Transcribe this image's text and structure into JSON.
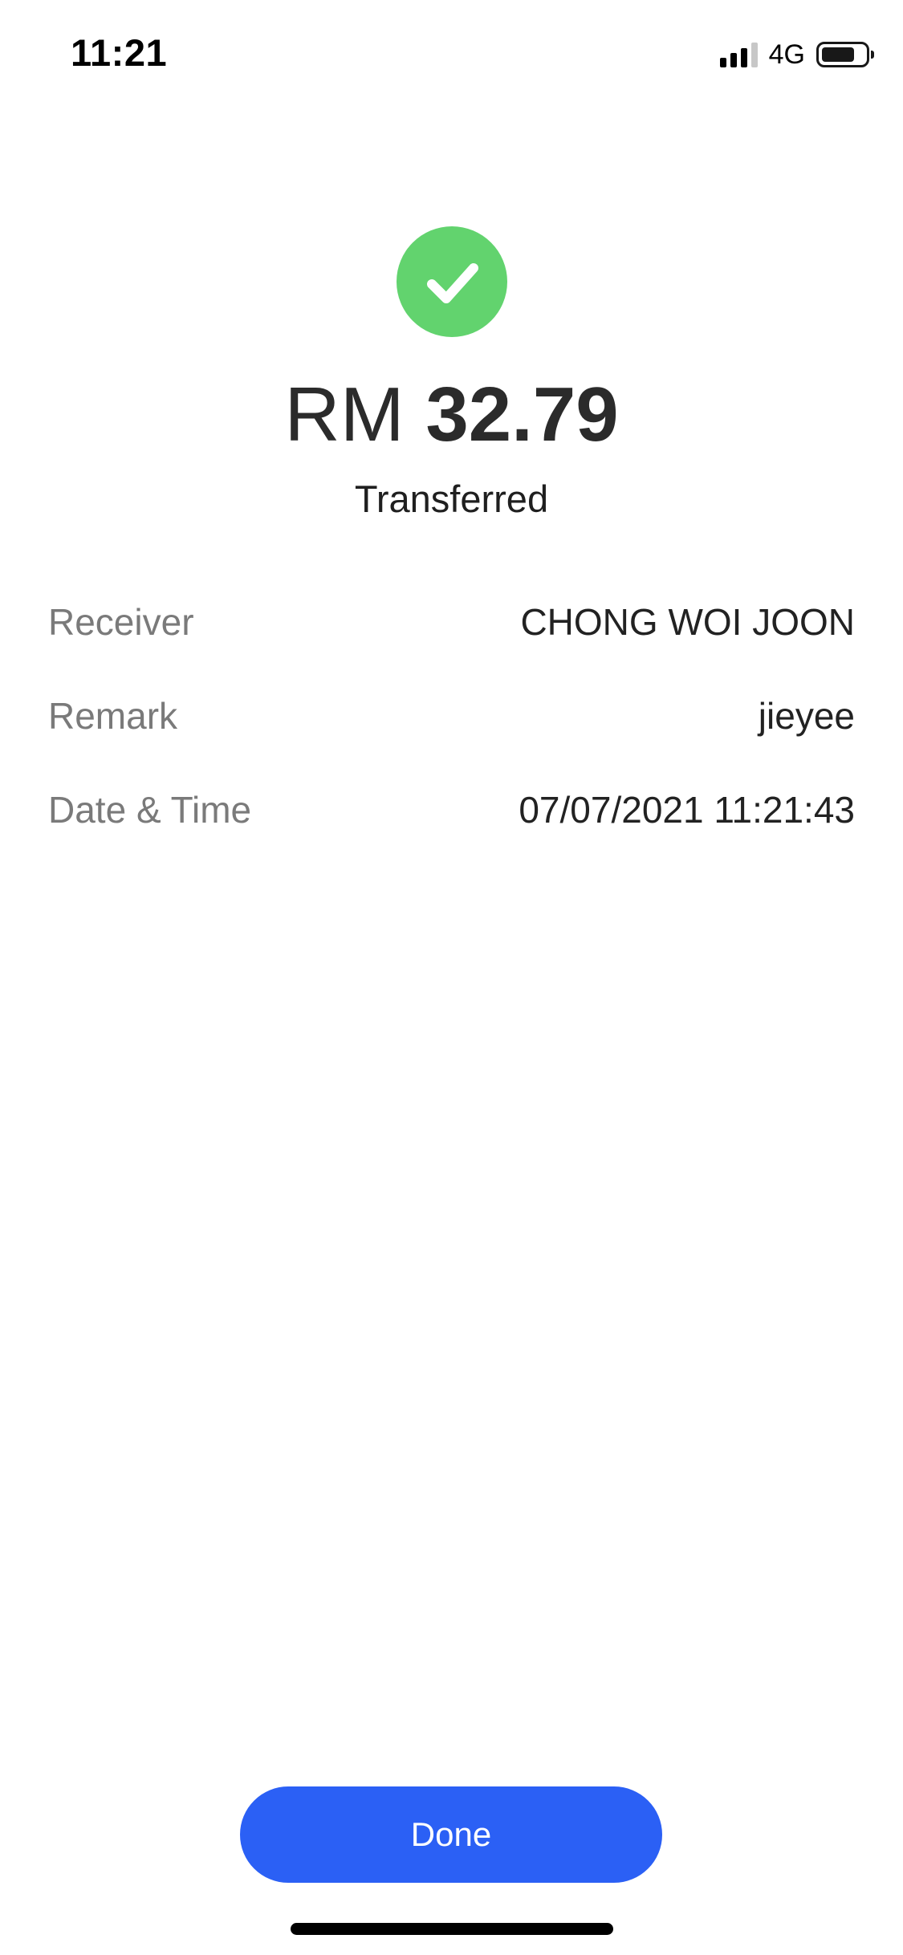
{
  "status_bar": {
    "time": "11:21",
    "network": "4G"
  },
  "receipt": {
    "currency": "RM",
    "amount": "32.79",
    "status": "Transferred",
    "accent_color": "#62d36e"
  },
  "details": [
    {
      "label": "Receiver",
      "value": "CHONG WOI JOON"
    },
    {
      "label": "Remark",
      "value": "jieyee"
    },
    {
      "label": "Date & Time",
      "value": "07/07/2021 11:21:43"
    }
  ],
  "actions": {
    "done_label": "Done",
    "button_color": "#2b60f5"
  }
}
